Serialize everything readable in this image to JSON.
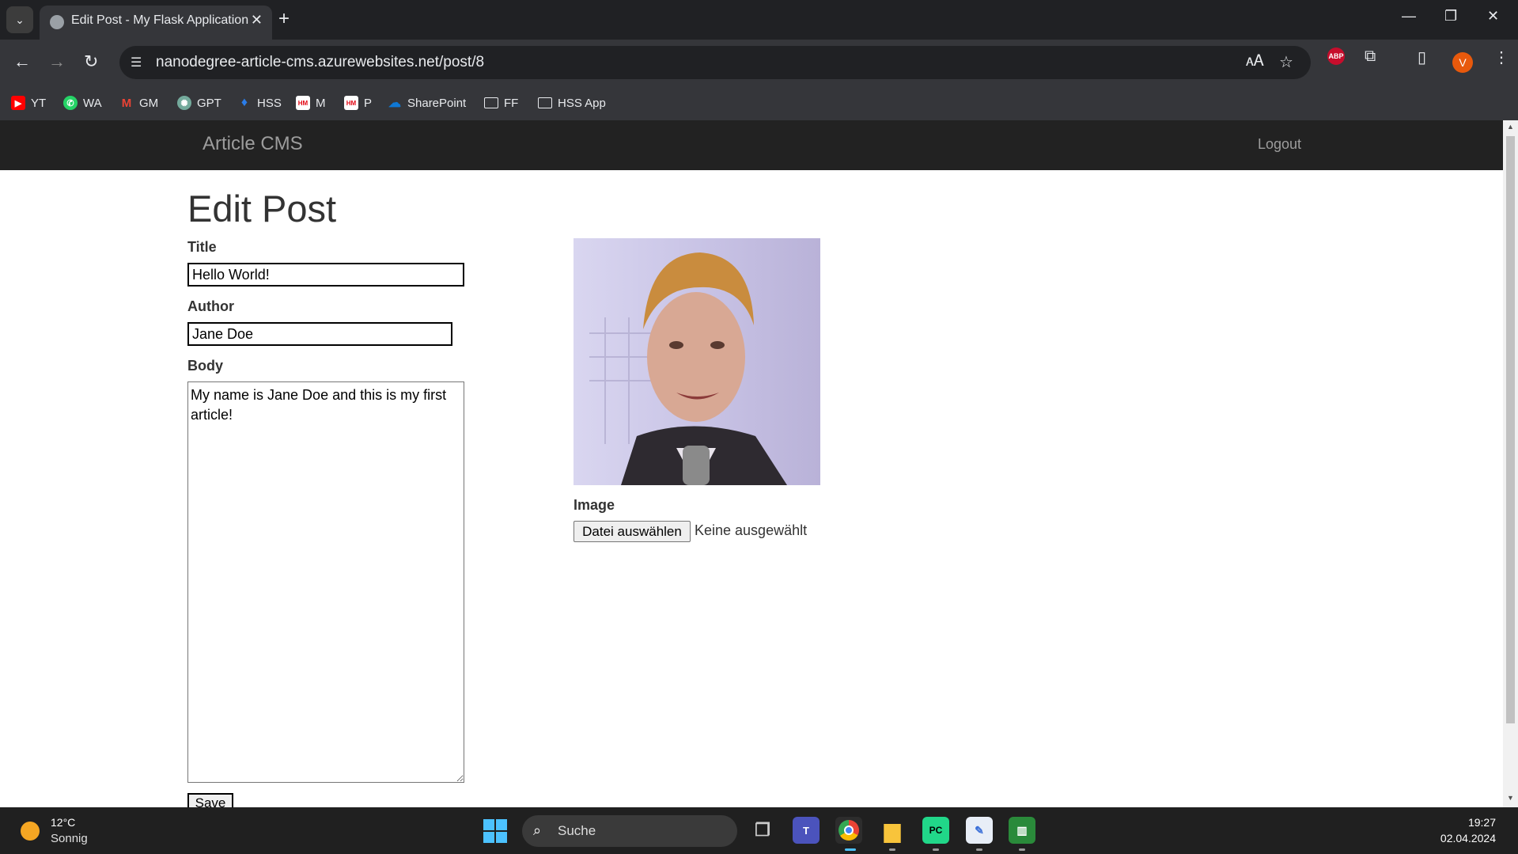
{
  "browser": {
    "tab_title": "Edit Post - My Flask Application",
    "url": "nanodegree-article-cms.azurewebsites.net/post/8",
    "profile_initial": "V",
    "extension_abp": "ABP",
    "bookmarks": [
      {
        "label": "YT",
        "icon": "youtube-icon",
        "color": "#ff0000"
      },
      {
        "label": "WA",
        "icon": "whatsapp-icon",
        "color": "#25d366"
      },
      {
        "label": "GM",
        "icon": "gmail-icon",
        "color": "#ea4335"
      },
      {
        "label": "GPT",
        "icon": "chatgpt-icon",
        "color": "#74aa9c"
      },
      {
        "label": "HSS",
        "icon": "hss-icon",
        "color": "#2b7de9"
      },
      {
        "label": "M",
        "icon": "hm-icon",
        "color": "#e30613"
      },
      {
        "label": "P",
        "icon": "hm-icon",
        "color": "#e30613"
      },
      {
        "label": "SharePoint",
        "icon": "onedrive-icon",
        "color": "#0f78d4"
      },
      {
        "label": "FF",
        "icon": "folder-icon",
        "color": "#e8eaed"
      },
      {
        "label": "HSS App",
        "icon": "folder-icon",
        "color": "#e8eaed"
      }
    ]
  },
  "app": {
    "brand": "Article CMS",
    "logout": "Logout",
    "heading": "Edit Post",
    "form": {
      "title_label": "Title",
      "title_value": "Hello World!",
      "author_label": "Author",
      "author_value": "Jane Doe",
      "body_label": "Body",
      "body_value": "My name is Jane Doe and this is my first article!",
      "image_label": "Image",
      "file_button": "Datei auswählen",
      "file_status": "Keine ausgewählt",
      "save_button": "Save"
    }
  },
  "taskbar": {
    "temperature": "12°C",
    "condition": "Sonnig",
    "search_text": "Suche",
    "time": "19:27",
    "date": "02.04.2024"
  },
  "colors": {
    "navbar": "#222222",
    "navbar_text": "#9d9d9d",
    "chrome_dark": "#202124",
    "chrome_toolbar": "#35363a"
  }
}
